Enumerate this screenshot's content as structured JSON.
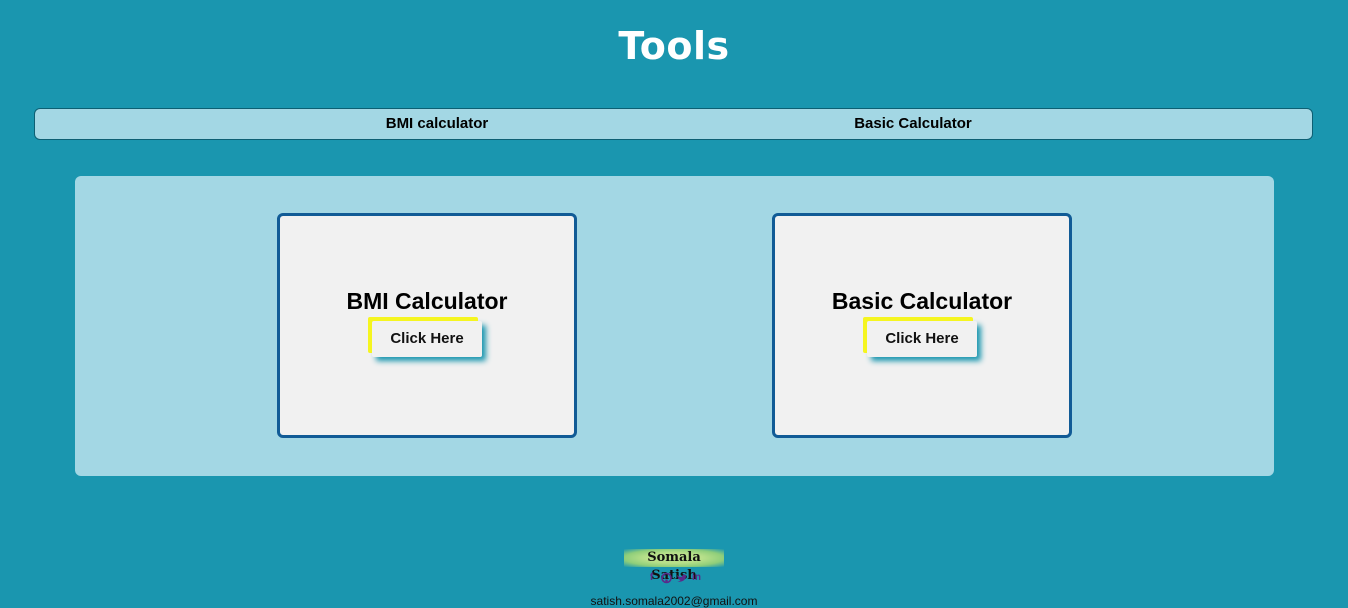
{
  "page": {
    "title": "Tools"
  },
  "nav": {
    "items": [
      {
        "label": "BMI calculator"
      },
      {
        "label": "Basic Calculator"
      }
    ]
  },
  "cards": [
    {
      "title": "BMI Calculator",
      "button_label": "Click Here"
    },
    {
      "title": "Basic Calculator",
      "button_label": "Click Here"
    }
  ],
  "footer": {
    "name": "Somala Satish",
    "social_icons": [
      "facebook-icon",
      "github-icon",
      "twitter-icon",
      "linkedin-icon"
    ],
    "email": "satish.somala2002@gmail.com"
  },
  "colors": {
    "background": "#1a96af",
    "panel": "#a3d7e4",
    "card_border": "#115b96",
    "button_accent": "#f5f520",
    "icon": "#5b2a8a"
  }
}
